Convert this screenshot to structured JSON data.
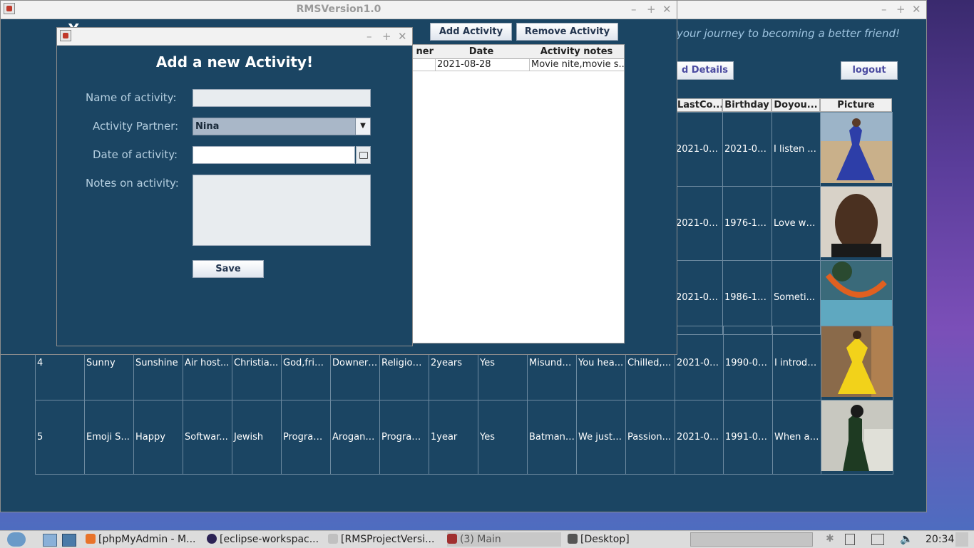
{
  "main_window": {
    "title": "RMSVersion1.0",
    "subtitle": "your journey to becoming a better friend!",
    "details_button": "d Details",
    "logout_button": "logout",
    "headers": [
      "LastCo...",
      "Birthday",
      "Doyou...",
      "Picture"
    ],
    "rows": [
      {
        "last": "2021-06...",
        "birthday": "2021-08...",
        "doyou": "I listen ..."
      },
      {
        "last": "2021-08...",
        "birthday": "1976-11...",
        "doyou": "Love wa..."
      },
      {
        "last": "2021-08...",
        "birthday": "1986-11...",
        "doyou": "Someti..."
      }
    ],
    "full_rows": [
      [
        "4",
        "Sunny",
        "Sunshine",
        "Air host...",
        "Christia...",
        "God,frie...",
        "Downers...",
        "Religion,...",
        "2years",
        "Yes",
        "Misunde...",
        "You hea...",
        "Chilled,f...",
        "2021-08...",
        "1990-08...",
        "I introdu..."
      ],
      [
        "5",
        "Emoji S...",
        "Happy",
        "Softwar...",
        "Jewish",
        "Program...",
        "Arogant ...",
        "Program...",
        "1year",
        "Yes",
        "Batman ...",
        "We just ...",
        "Passion...",
        "2021-08...",
        "1991-08...",
        "When a ..."
      ]
    ]
  },
  "activity_window": {
    "heading_partial": "Y",
    "add_button": "Add Activity",
    "remove_button": "Remove Activity",
    "headers": [
      "ner",
      "Date",
      "Activity notes"
    ],
    "row": {
      "date": "2021-08-28",
      "notes": "Movie nite,movie s..."
    }
  },
  "dialog": {
    "heading": "Add a new Activity!",
    "name_label": "Name of activity:",
    "name_value": "",
    "partner_label": "Activity Partner:",
    "partner_value": "Nina",
    "date_label": "Date of activity:",
    "date_value": "",
    "notes_label": "Notes on activity:",
    "notes_value": "",
    "save_button": "Save"
  },
  "taskbar": {
    "tasks": [
      "[phpMyAdmin - M...",
      "[eclipse-workspac...",
      "[RMSProjectVersi...",
      "(3) Main",
      "[Desktop]"
    ],
    "clock": "20:34"
  },
  "colors": {
    "window_bg": "#1b4563",
    "accent": "#4a4aa0"
  }
}
